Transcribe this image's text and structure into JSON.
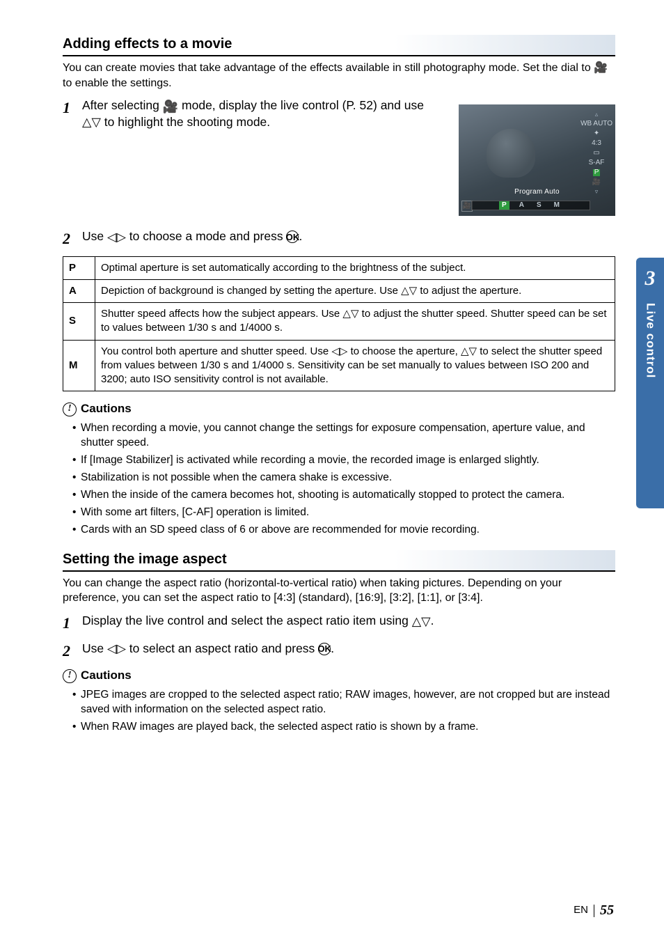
{
  "sideTab": {
    "number": "3",
    "label": "Live control"
  },
  "section1": {
    "title": "Adding effects to a movie",
    "intro": "You can create movies that take advantage of the effects available in still photography mode. Set the dial to 🎥 to enable the settings.",
    "step1_a": "After selecting ",
    "step1_b": " mode, display the live control (P. 52) and use ",
    "step1_c": " to highlight the shooting mode.",
    "step2_a": "Use ",
    "step2_b": " to choose a mode and press ",
    "step2_c": "."
  },
  "thumb": {
    "label": "Program Auto",
    "corner": "🎥",
    "barItems": [
      "P",
      "A",
      "S",
      "M"
    ],
    "rightIcons": [
      "WB AUTO",
      "✦",
      "4:3",
      "▭",
      "S-AF",
      "P",
      "🎥"
    ]
  },
  "modesTable": [
    {
      "key": "P",
      "text": "Optimal aperture is set automatically according to the brightness of the subject."
    },
    {
      "key": "A",
      "text": "Depiction of background is changed by setting the aperture. Use △▽ to adjust the aperture."
    },
    {
      "key": "S",
      "text": "Shutter speed affects how the subject appears. Use △▽ to adjust the shutter speed. Shutter speed can be set to values between 1/30 s and 1/4000 s."
    },
    {
      "key": "M",
      "text": "You control both aperture and shutter speed. Use ◁▷ to choose the aperture, △▽ to select the shutter speed from values between 1/30 s and 1/4000 s. Sensitivity can be set manually to values between ISO 200 and 3200; auto ISO sensitivity control is not available."
    }
  ],
  "cautionsLabel": "Cautions",
  "cautions1": [
    "When recording a movie, you cannot change the settings for exposure compensation, aperture value, and shutter speed.",
    "If [Image Stabilizer] is activated while recording a movie, the recorded image is enlarged slightly.",
    "Stabilization is not possible when the camera shake is excessive.",
    "When the inside of the camera becomes hot, shooting is automatically stopped to protect the camera.",
    "With some art filters, [C-AF] operation is limited.",
    "Cards with an SD speed class of 6 or above are recommended for movie recording."
  ],
  "section2": {
    "title": "Setting the image aspect",
    "intro": "You can change the aspect ratio (horizontal-to-vertical ratio) when taking pictures. Depending on your preference, you can set the aspect ratio to [4:3] (standard), [16:9], [3:2], [1:1], or [3:4].",
    "step1_a": "Display the live control and select the aspect ratio item using ",
    "step1_b": ".",
    "step2_a": "Use ",
    "step2_b": " to select an aspect ratio and press ",
    "step2_c": "."
  },
  "cautions2": [
    "JPEG images are cropped to the selected aspect ratio; RAW images, however, are not cropped but are instead saved with information on the selected aspect ratio.",
    "When RAW images are played back, the selected aspect ratio is shown by a frame."
  ],
  "footer": {
    "lang": "EN",
    "page": "55"
  },
  "glyphs": {
    "triUD": "△▽",
    "triLR": "◁▷",
    "ok": "OK",
    "movie": "🎥"
  }
}
